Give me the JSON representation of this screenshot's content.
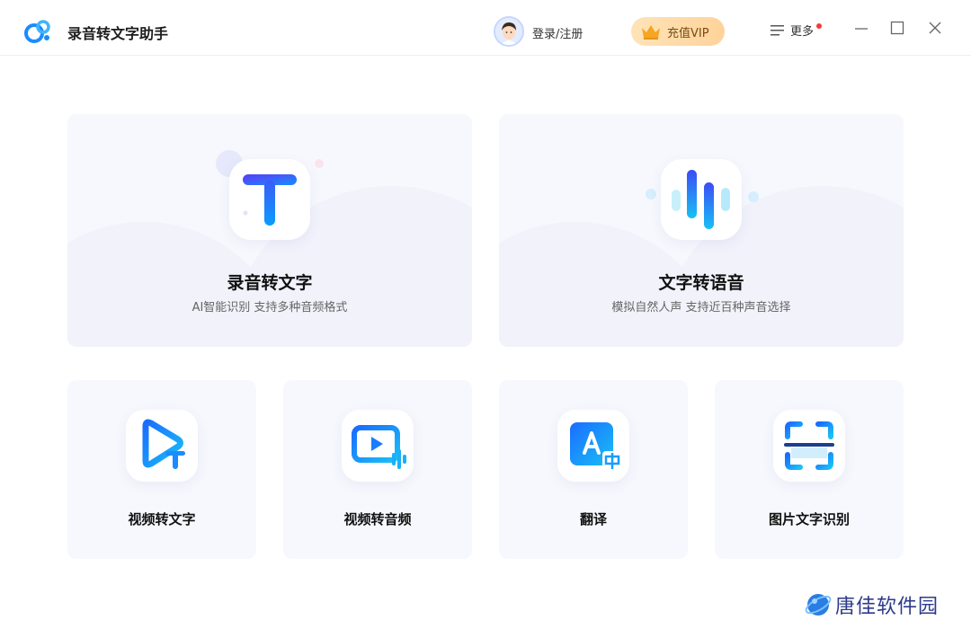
{
  "app": {
    "title": "录音转文字助手"
  },
  "header": {
    "login_label": "登录/注册",
    "vip_label": "充值VIP",
    "more_label": "更多"
  },
  "features": {
    "big": [
      {
        "title": "录音转文字",
        "subtitle": "AI智能识别 支持多种音频格式"
      },
      {
        "title": "文字转语音",
        "subtitle": "模拟自然人声 支持近百种声音选择"
      }
    ],
    "small": [
      {
        "title": "视频转文字"
      },
      {
        "title": "视频转音频"
      },
      {
        "title": "翻译"
      },
      {
        "title": "图片文字识别"
      }
    ]
  },
  "watermark": {
    "text": "唐佳软件园"
  },
  "colors": {
    "accent": "#1a8cff",
    "vip_bg": "#ffd9a3",
    "card_bg": "#f7f8fd",
    "badge_dot": "#f23b3b"
  }
}
